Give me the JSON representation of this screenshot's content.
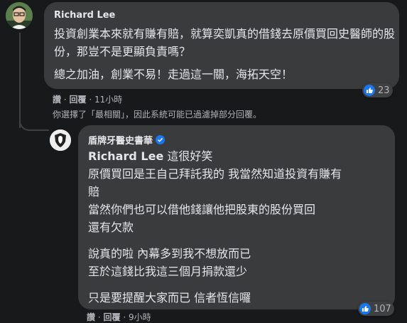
{
  "comment": {
    "author": "Richard Lee",
    "paragraph1": "投資創業本來就有賺有賠，就算奕凱真的借錢去原價買回史醫師的股份，那豈不是更顯負責嗎？",
    "paragraph2": "總之加油，創業不易！走過這一關，海拓天空！",
    "like_label": "讚",
    "reply_label": "回覆",
    "separator": "·",
    "time": "11小時",
    "reaction_count": "23"
  },
  "filter_notice": "你選擇了「最相關」，因此系統可能已過濾掉部分回覆。",
  "reply": {
    "author": "盾牌牙醫史書華",
    "mention": "Richard Lee",
    "mention_suffix": " 這很好笑",
    "lines1": [
      "原價買回是王自己拜託我的 我當然知道投資有賺有",
      "賠",
      "當然你們也可以借他錢讓他把股東的股份買回",
      "還有欠款"
    ],
    "lines2": [
      "說真的啦 內幕多到我不想放而已",
      "至於這錢比我這三個月捐款還少"
    ],
    "lines3": [
      "只是要提醒大家而已 信者恆信囉"
    ],
    "like_label": "讚",
    "reply_label": "回覆",
    "separator": "·",
    "time": "9小時",
    "reaction_count": "107"
  },
  "colors": {
    "background": "#18191a",
    "bubble": "#3a3b3c",
    "text": "#e4e6eb",
    "secondary": "#b0b3b8",
    "like_blue": "#1877f2"
  }
}
